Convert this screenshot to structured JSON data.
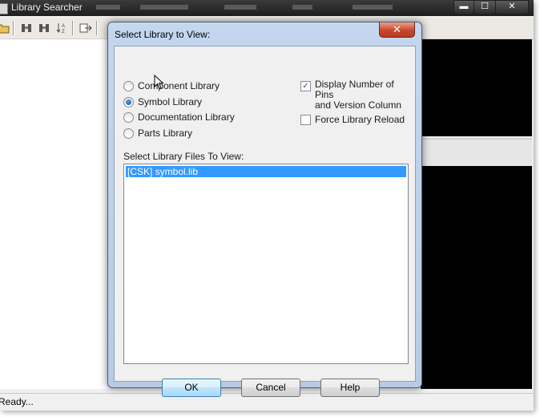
{
  "main_window": {
    "title": "Library Searcher",
    "status_text": "Ready...",
    "window_buttons": {
      "minimize": "▬",
      "maximize": "☐",
      "close": "✕"
    },
    "toolbar_icons": [
      "open-folder-icon",
      "binoculars-icon",
      "binoculars-next-icon",
      "sort-icon",
      "export-icon"
    ]
  },
  "dialog": {
    "title": "Select Library to View:",
    "close_glyph": "✕",
    "library_type_options": [
      {
        "label": "Component Library",
        "checked": false
      },
      {
        "label": "Symbol Library",
        "checked": true
      },
      {
        "label": "Documentation Library",
        "checked": false
      },
      {
        "label": "Parts Library",
        "checked": false
      }
    ],
    "display_pins_checkbox": {
      "label_line1": "Display Number of Pins",
      "label_line2": "and Version Column",
      "checked": true
    },
    "force_reload_checkbox": {
      "label": "Force Library Reload",
      "checked": false
    },
    "files_label": "Select Library Files To View:",
    "files": [
      {
        "name": "[CSK] symbol.lib",
        "selected": true
      }
    ],
    "buttons": {
      "ok": "OK",
      "cancel": "Cancel",
      "help": "Help"
    }
  },
  "colors": {
    "selection": "#3399ff",
    "dialog_frame": "#c4d7ee",
    "close_button": "#c8462b"
  }
}
